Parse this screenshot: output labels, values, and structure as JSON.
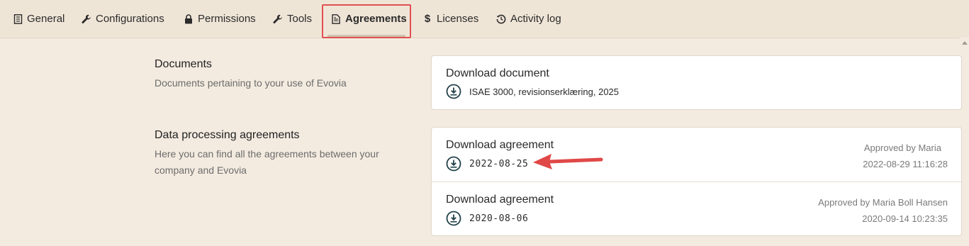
{
  "tabs": [
    {
      "id": "general",
      "label": "General",
      "icon": "ledger-icon"
    },
    {
      "id": "configurations",
      "label": "Configurations",
      "icon": "wrench-icon"
    },
    {
      "id": "permissions",
      "label": "Permissions",
      "icon": "lock-icon"
    },
    {
      "id": "tools",
      "label": "Tools",
      "icon": "wrench-icon"
    },
    {
      "id": "agreements",
      "label": "Agreements",
      "icon": "document-icon",
      "active": true
    },
    {
      "id": "licenses",
      "label": "Licenses",
      "icon": "dollar-icon"
    },
    {
      "id": "activity",
      "label": "Activity log",
      "icon": "history-icon"
    }
  ],
  "documents": {
    "title": "Documents",
    "description": "Documents pertaining to your use of Evovia",
    "card": {
      "title": "Download document",
      "file": "ISAE 3000, revisionserklæring, 2025"
    }
  },
  "dpa": {
    "title": "Data processing agreements",
    "description": "Here you can find all the agreements between your company and Evovia",
    "rows": [
      {
        "title": "Download agreement",
        "date": "2022-08-25",
        "approved_by": "Approved by Maria",
        "timestamp": "2022-08-29 11:16:28"
      },
      {
        "title": "Download agreement",
        "date": "2020-08-06",
        "approved_by": "Approved by Maria Boll Hansen",
        "timestamp": "2020-09-14 10:23:35"
      }
    ]
  },
  "colors": {
    "background": "#f3ebe0",
    "tabbar": "#efe5d7",
    "highlight": "#e05050",
    "icon": "#22414a"
  }
}
